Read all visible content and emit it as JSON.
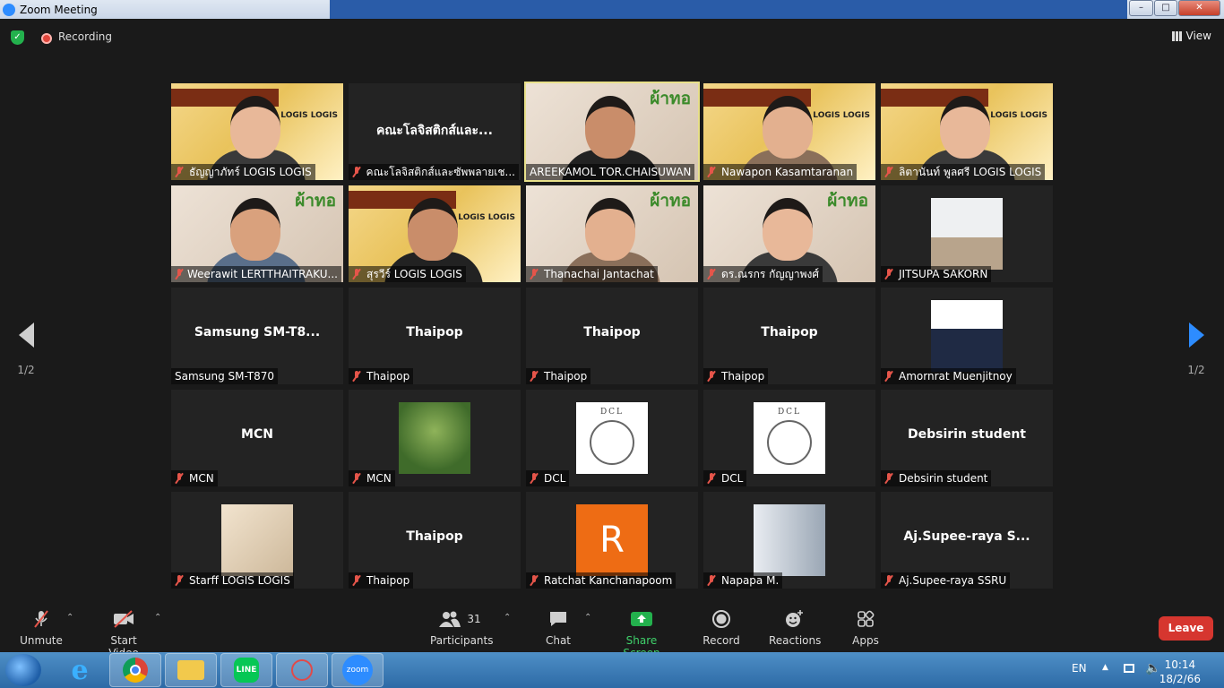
{
  "window": {
    "title": "Zoom Meeting"
  },
  "topbar": {
    "recording_label": "Recording",
    "view_label": "View"
  },
  "pagination": {
    "left": "1/2",
    "right": "1/2"
  },
  "tiles": [
    {
      "name": "ธัญญาภัทร์ LOGIS LOGIS",
      "big": "",
      "muted": true,
      "kind": "ppt",
      "ppt_text": "ทีม LOGIS LOGIS"
    },
    {
      "name": "คณะโลจิสติกส์และซัพพลายเช...",
      "big": "คณะโลจิสติกส์และ...",
      "muted": true,
      "kind": "none"
    },
    {
      "name": "AREEKAMOL TOR.CHAISUWAN",
      "big": "",
      "muted": false,
      "kind": "pha",
      "ppt_text": "ผ้าทอ",
      "active": true
    },
    {
      "name": "Nawapon Kasamtaranan",
      "big": "",
      "muted": true,
      "kind": "ppt",
      "ppt_text": "ทีม LOGIS LOGIS"
    },
    {
      "name": "ลิตานันท์ พูลศรี LOGIS LOGIS",
      "big": "",
      "muted": true,
      "kind": "ppt",
      "ppt_text": "ทีม LOGIS LOGIS"
    },
    {
      "name": "Weerawit LERTTHAITRAKU...",
      "big": "",
      "muted": true,
      "kind": "pha",
      "ppt_text": "ผ้าทอ"
    },
    {
      "name": "สุรวีร์ LOGIS LOGIS",
      "big": "",
      "muted": true,
      "kind": "ppt",
      "ppt_text": "ทีม LOGIS LOGIS"
    },
    {
      "name": "Thanachai Jantachat",
      "big": "",
      "muted": true,
      "kind": "pha",
      "ppt_text": "ผ้าทอ"
    },
    {
      "name": "ดร.ณรกร กัญญาพงศ์",
      "big": "",
      "muted": true,
      "kind": "pha",
      "ppt_text": "ผ้าทอ"
    },
    {
      "name": "JITSUPA  SAKORN",
      "big": "",
      "muted": true,
      "kind": "thumb-photo"
    },
    {
      "name": "Samsung SM-T870",
      "big": "Samsung  SM-T8...",
      "muted": false,
      "kind": "none"
    },
    {
      "name": "Thaipop",
      "big": "Thaipop",
      "muted": true,
      "kind": "none"
    },
    {
      "name": "Thaipop",
      "big": "Thaipop",
      "muted": true,
      "kind": "none"
    },
    {
      "name": "Thaipop",
      "big": "Thaipop",
      "muted": true,
      "kind": "none"
    },
    {
      "name": "Amornrat  Muenjitnoy",
      "big": "",
      "muted": true,
      "kind": "thumb-portrait"
    },
    {
      "name": "MCN",
      "big": "MCN",
      "muted": true,
      "kind": "none"
    },
    {
      "name": "MCN",
      "big": "",
      "muted": true,
      "kind": "thumb-nature"
    },
    {
      "name": "DCL",
      "big": "",
      "muted": true,
      "kind": "thumb-dcl"
    },
    {
      "name": "DCL",
      "big": "",
      "muted": true,
      "kind": "thumb-dcl"
    },
    {
      "name": "Debsirin student",
      "big": "Debsirin student",
      "muted": true,
      "kind": "none"
    },
    {
      "name": "Starff LOGIS LOGIS",
      "big": "",
      "muted": true,
      "kind": "thumb-ppt"
    },
    {
      "name": "Thaipop",
      "big": "Thaipop",
      "muted": true,
      "kind": "none"
    },
    {
      "name": "Ratchat  Kanchanapoom",
      "big": "",
      "muted": true,
      "kind": "thumb-letter",
      "letter": "R"
    },
    {
      "name": "Napapa M.",
      "big": "",
      "muted": true,
      "kind": "thumb-portrait2"
    },
    {
      "name": "Aj.Supee-raya SSRU",
      "big": "Aj.Supee-raya  S...",
      "muted": true,
      "kind": "none"
    }
  ],
  "dcl_text": "DCL",
  "toolbar": {
    "unmute": "Unmute",
    "start_video": "Start Video",
    "participants": "Participants",
    "participants_count": "31",
    "chat": "Chat",
    "share_screen": "Share Screen",
    "record": "Record",
    "reactions": "Reactions",
    "apps": "Apps",
    "leave": "Leave"
  },
  "taskbar": {
    "apps": [
      "internet-explorer",
      "chrome",
      "file-explorer",
      "line",
      "snipping-tool",
      "zoom"
    ],
    "line_label": "LINE",
    "zoom_label": "zoom",
    "lang": "EN",
    "time": "10:14",
    "date": "18/2/66"
  },
  "colors": {
    "accent": "#2d8cff",
    "leave": "#d6362f",
    "share": "#23b14d",
    "mute_red": "#e5554a"
  }
}
